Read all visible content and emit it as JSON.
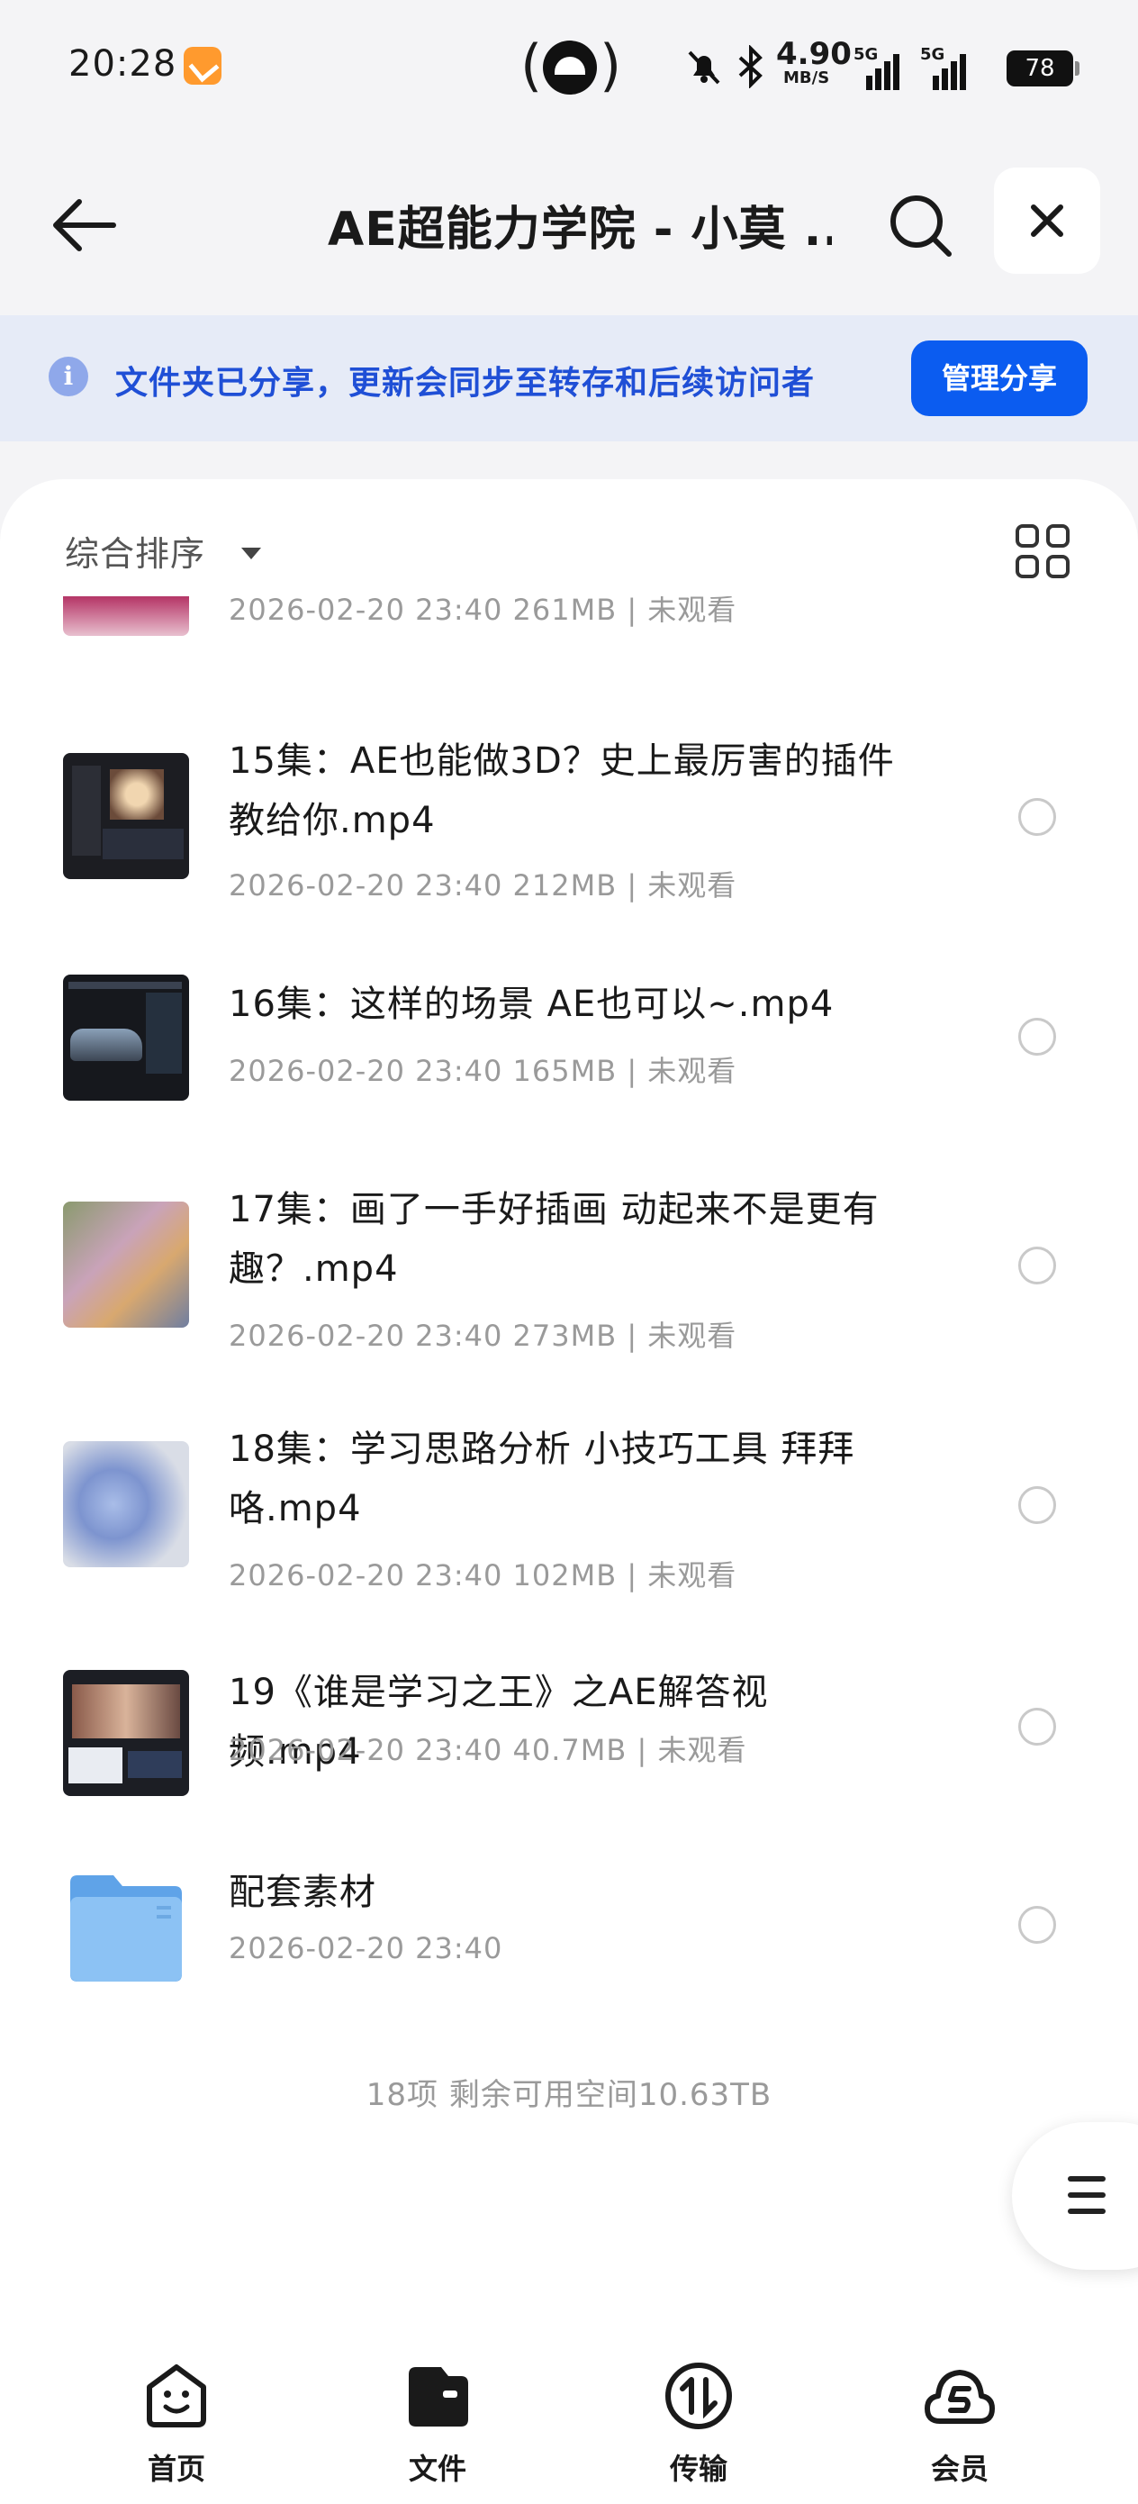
{
  "status_bar": {
    "time": "20:28",
    "net_speed": "4.90",
    "net_unit": "MB/S",
    "signal1_label": "5G",
    "signal2_label": "5G",
    "battery": "78"
  },
  "header": {
    "title": "AE超能力学院 - 小莫 ..."
  },
  "share_banner": {
    "text": "文件夹已分享，更新会同步至转存和后续访问者",
    "button_label": "管理分享"
  },
  "toolbar": {
    "sort_label": "综合排序"
  },
  "files": [
    {
      "name": "",
      "meta": "2026-02-20 23:40  261MB | 未观看",
      "kind": "video",
      "thumb": "partial"
    },
    {
      "name": "15集：AE也能做3D？史上最厉害的插件教给你.mp4",
      "meta": "2026-02-20 23:40  212MB | 未观看",
      "kind": "video",
      "thumb": "dark-ui"
    },
    {
      "name": "16集：这样的场景 AE也可以~.mp4",
      "meta": "2026-02-20 23:40  165MB | 未观看",
      "kind": "video",
      "thumb": "dark-car"
    },
    {
      "name": "17集：画了一手好插画 动起来不是更有趣？.mp4",
      "meta": "2026-02-20 23:40  273MB | 未观看",
      "kind": "video",
      "thumb": "illustration"
    },
    {
      "name": "18集：学习思路分析 小技巧工具 拜拜咯.mp4",
      "meta": "2026-02-20 23:40  102MB | 未观看",
      "kind": "video",
      "thumb": "flowers"
    },
    {
      "name": "19《谁是学习之王》之AE解答视频.mp4",
      "meta": "2026-02-20 23:40  40.7MB | 未观看",
      "kind": "video",
      "thumb": "dark-ui-2"
    },
    {
      "name": "配套素材",
      "meta": "2026-02-20 23:40",
      "kind": "folder",
      "thumb": "folder"
    }
  ],
  "summary": "18项  剩余可用空间10.63TB",
  "bottom_nav": [
    {
      "label": "首页",
      "icon": "home-face-icon"
    },
    {
      "label": "文件",
      "icon": "folder-wallet-icon"
    },
    {
      "label": "传输",
      "icon": "transfer-icon"
    },
    {
      "label": "会员",
      "icon": "vip-cloud-icon"
    }
  ],
  "colors": {
    "accent": "#0b5cf0",
    "banner_text": "#1f4fd6",
    "banner_bg": "#e6ebf7",
    "page_bg": "#f4f4f6"
  }
}
